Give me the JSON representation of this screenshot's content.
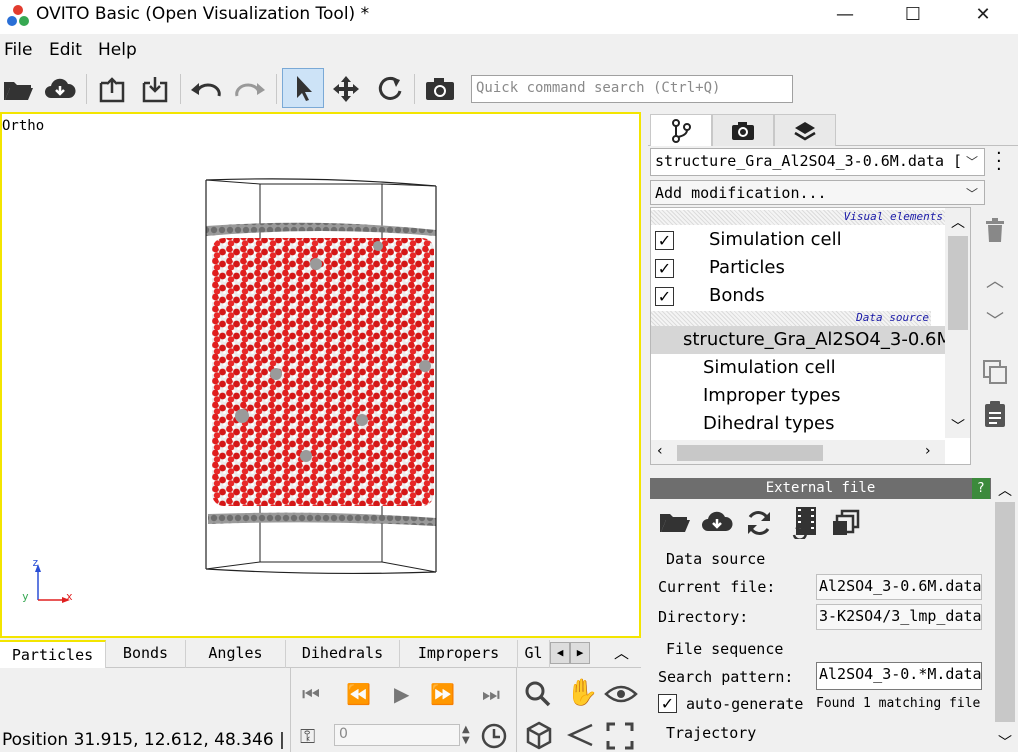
{
  "window": {
    "title": "OVITO Basic (Open Visualization Tool) *",
    "minimize": "—",
    "maximize": "☐",
    "close": "✕"
  },
  "menu": [
    "File",
    "Edit",
    "Help"
  ],
  "toolbar": {
    "search_placeholder": "Quick command search (Ctrl+Q)"
  },
  "viewport": {
    "label": "Ortho",
    "axis_z": "z",
    "axis_y": "y",
    "axis_x": "x",
    "accent": "#f3e500"
  },
  "data_tabs": [
    "Particles",
    "Bonds",
    "Angles",
    "Dihedrals",
    "Impropers",
    "Gl"
  ],
  "status": {
    "position": "Position 31.915, 12.612, 48.346 |",
    "frame": "0"
  },
  "pipeline": {
    "source_combo": "structure_Gra_Al2SO4_3-0.6M.data [",
    "add_modification": "Add modification...",
    "visual_header": "Visual elements",
    "visual_elements": [
      {
        "label": "Simulation cell",
        "checked": true
      },
      {
        "label": "Particles",
        "checked": true
      },
      {
        "label": "Bonds",
        "checked": true
      }
    ],
    "source_header": "Data source",
    "source_item": "structure_Gra_Al2SO4_3-0.6M.",
    "sub_items": [
      "Simulation cell",
      "Improper types",
      "Dihedral types"
    ]
  },
  "external_file": {
    "header": "External file",
    "help": "?",
    "data_source_group": "Data source",
    "current_file_label": "Current file:",
    "current_file_value": "Al2SO4_3-0.6M.data",
    "directory_label": "Directory:",
    "directory_value": "3-K2SO4/3_lmp_data",
    "file_sequence_group": "File sequence",
    "search_pattern_label": "Search pattern:",
    "search_pattern_value": "Al2SO4_3-0.*M.data",
    "auto_generate_label": "auto-generate",
    "found_text": "Found 1 matching file",
    "trajectory_group": "Trajectory"
  }
}
